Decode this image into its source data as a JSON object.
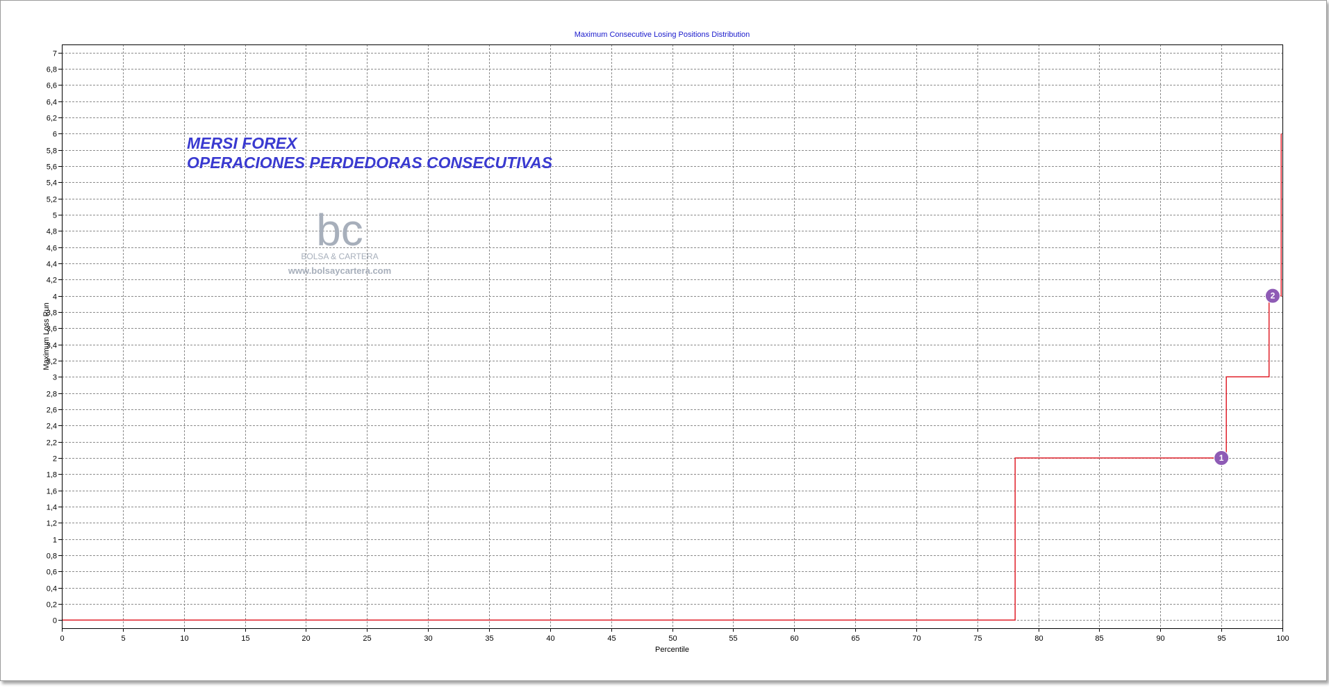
{
  "chart_data": {
    "type": "line",
    "title": "Maximum Consecutive Losing Positions Distribution",
    "xlabel": "Percentile",
    "ylabel": "Maximum Loss Run",
    "xlim": [
      0,
      100
    ],
    "ylim": [
      -0.1,
      7.1
    ],
    "x_ticks": [
      0,
      5,
      10,
      15,
      20,
      25,
      30,
      35,
      40,
      45,
      50,
      55,
      60,
      65,
      70,
      75,
      80,
      85,
      90,
      95,
      100
    ],
    "y_ticks": [
      "0",
      "0,2",
      "0,4",
      "0,6",
      "0,8",
      "1",
      "1,2",
      "1,4",
      "1,6",
      "1,8",
      "2",
      "2,2",
      "2,4",
      "2,6",
      "2,8",
      "3",
      "3,2",
      "3,4",
      "3,6",
      "3,8",
      "4",
      "4,2",
      "4,4",
      "4,6",
      "4,8",
      "5",
      "5,2",
      "5,4",
      "5,6",
      "5,8",
      "6",
      "6,2",
      "6,4",
      "6,6",
      "6,8",
      "7"
    ],
    "grid": true,
    "series": [
      {
        "color": "#e0202a",
        "step": true,
        "points": [
          [
            0,
            0
          ],
          [
            78.1,
            0
          ],
          [
            78.1,
            2
          ],
          [
            95.4,
            2
          ],
          [
            95.4,
            3
          ],
          [
            98.9,
            3
          ],
          [
            98.9,
            4
          ],
          [
            99.9,
            4
          ],
          [
            99.9,
            6
          ]
        ]
      }
    ],
    "markers": [
      {
        "label": "1",
        "x": 95.0,
        "y": 2,
        "color": "#8e5bb5"
      },
      {
        "label": "2",
        "x": 99.2,
        "y": 4,
        "color": "#8e5bb5"
      }
    ],
    "annotation": [
      "MERSI FOREX",
      "OPERACIONES PERDEDORAS CONSECUTIVAS"
    ],
    "watermark": {
      "logo": "bc",
      "name": "BOLSA & CARTERA",
      "url": "www.bolsaycartera.com"
    }
  }
}
